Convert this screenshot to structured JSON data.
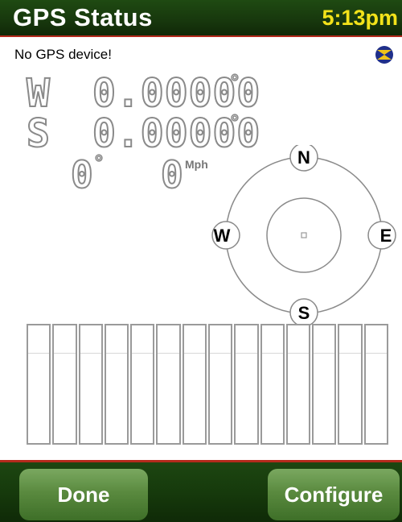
{
  "header": {
    "title": "GPS Status",
    "clock": "5:13pm"
  },
  "status": {
    "message": "No GPS device!",
    "icon": "satellite-icon"
  },
  "latitude": {
    "hemisphere": "W",
    "value": "0.00000",
    "unit": "°"
  },
  "longitude": {
    "hemisphere": "S",
    "value": "0.00000",
    "unit": "°"
  },
  "heading": {
    "value": "0",
    "unit": "°"
  },
  "speed": {
    "value": "0",
    "unit": "Mph"
  },
  "compass": {
    "north": "N",
    "east": "E",
    "south": "S",
    "west": "W"
  },
  "signal": {
    "bar_count": 14,
    "levels": [
      0,
      0,
      0,
      0,
      0,
      0,
      0,
      0,
      0,
      0,
      0,
      0,
      0,
      0
    ]
  },
  "footer": {
    "done_label": "Done",
    "configure_label": "Configure"
  },
  "colors": {
    "header_bg": "#17370d",
    "clock": "#f2e21a",
    "accent_line": "#b42a1c",
    "button": "#5a8a3f",
    "readout_stroke": "#8a8a8a"
  }
}
